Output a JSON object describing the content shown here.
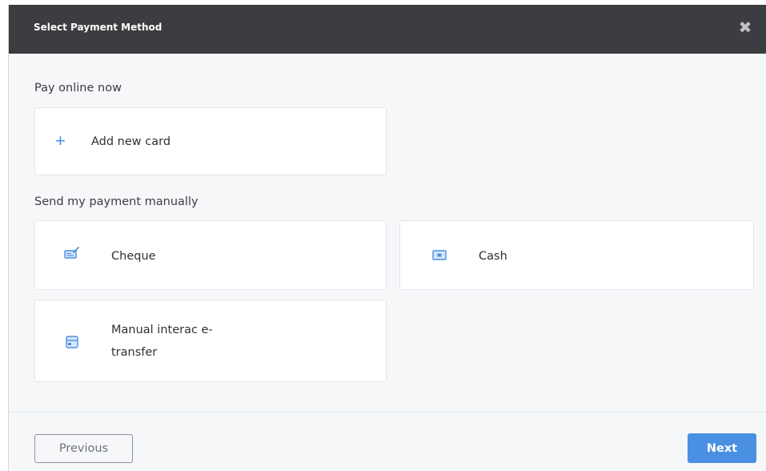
{
  "modal": {
    "title": "Select Payment Method",
    "close_glyph": "✖"
  },
  "online": {
    "heading": "Pay online now",
    "add_card": {
      "label": "Add new card",
      "icon": "plus-icon"
    }
  },
  "manual": {
    "heading": "Send my payment manually",
    "options": [
      {
        "label": "Cheque",
        "icon": "cheque-icon"
      },
      {
        "label": "Cash",
        "icon": "cash-icon"
      },
      {
        "label_line1": "Manual interac e-",
        "label_line2": "transfer",
        "icon": "transfer-icon"
      }
    ]
  },
  "footer": {
    "previous_label": "Previous",
    "next_label": "Next"
  },
  "colors": {
    "header_bg": "#3c3d40",
    "accent": "#4a90e2",
    "panel_bg": "#f6f7f9",
    "card_bg": "#ffffff"
  }
}
